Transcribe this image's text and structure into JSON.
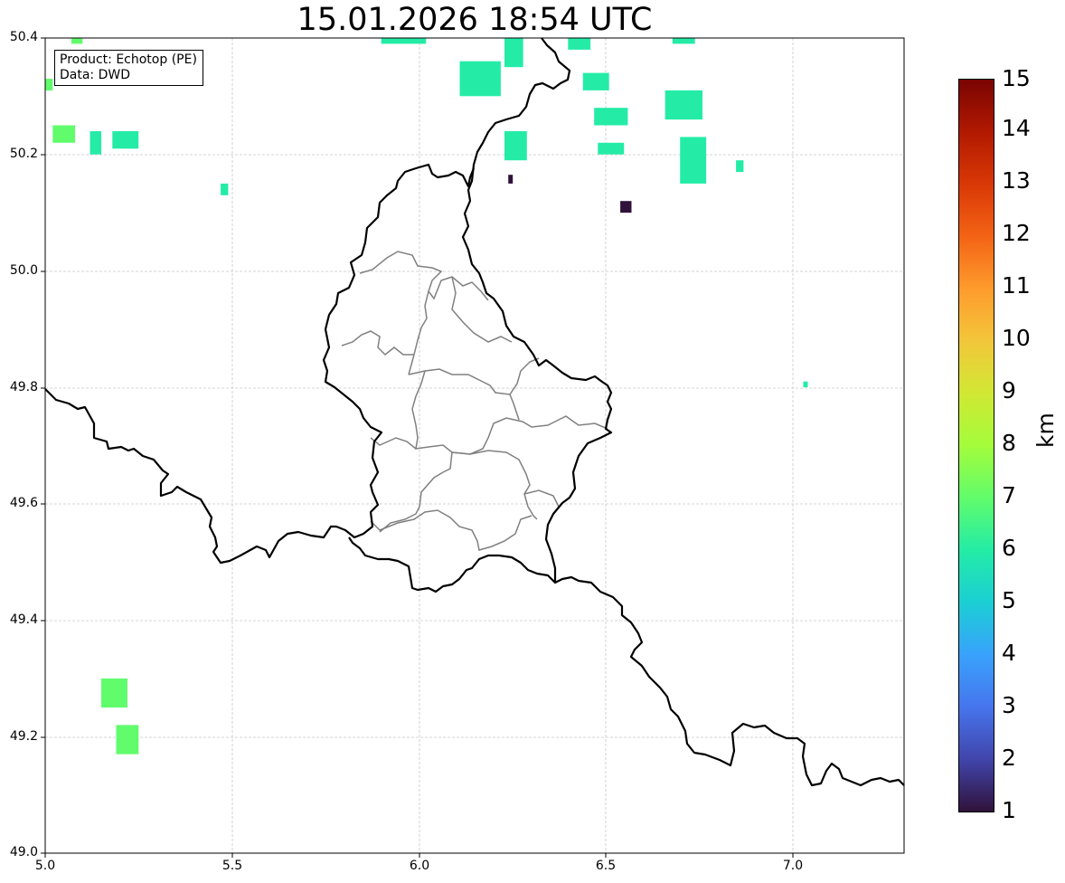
{
  "title": "15.01.2026 18:54 UTC",
  "info": {
    "product": "Product: Echotop (PE)",
    "data_source": "Data: DWD"
  },
  "axes": {
    "lon_range": [
      5.0,
      7.3
    ],
    "lat_range": [
      49.0,
      50.4
    ],
    "x_ticks": [
      "5.0",
      "5.5",
      "6.0",
      "6.5",
      "7.0"
    ],
    "y_ticks": [
      "49.0",
      "49.2",
      "49.4",
      "49.6",
      "49.8",
      "50.0",
      "50.2",
      "50.4"
    ],
    "grid": true
  },
  "colorbar": {
    "unit": "km",
    "range": [
      1,
      15
    ],
    "ticks": [
      "1",
      "2",
      "3",
      "4",
      "5",
      "6",
      "7",
      "8",
      "9",
      "10",
      "11",
      "12",
      "13",
      "14",
      "15"
    ],
    "colormap": [
      "#30123b",
      "#4145ab",
      "#4675ed",
      "#39a2fc",
      "#1bcfd4",
      "#24eca6",
      "#61fc6c",
      "#a4fc3b",
      "#d1e834",
      "#f3c63a",
      "#fe9b2d",
      "#f36315",
      "#d93806",
      "#b11901",
      "#7a0402"
    ]
  },
  "echo_cells": [
    {
      "lon_range": [
        5.0,
        5.02
      ],
      "lat_range": [
        50.31,
        50.33
      ],
      "height_km": 6.5
    },
    {
      "lon_range": [
        5.07,
        5.1
      ],
      "lat_range": [
        50.39,
        50.4
      ],
      "height_km": 6.5
    },
    {
      "lon_range": [
        5.02,
        5.08
      ],
      "lat_range": [
        50.22,
        50.25
      ],
      "height_km": 6.5
    },
    {
      "lon_range": [
        5.12,
        5.15
      ],
      "lat_range": [
        50.2,
        50.24
      ],
      "height_km": 6.3
    },
    {
      "lon_range": [
        5.18,
        5.25
      ],
      "lat_range": [
        50.21,
        50.24
      ],
      "height_km": 6.0
    },
    {
      "lon_range": [
        5.47,
        5.49
      ],
      "lat_range": [
        50.13,
        50.15
      ],
      "height_km": 6.0
    },
    {
      "lon_range": [
        5.15,
        5.22
      ],
      "lat_range": [
        49.25,
        49.3
      ],
      "height_km": 6.5
    },
    {
      "lon_range": [
        5.19,
        5.25
      ],
      "lat_range": [
        49.17,
        49.22
      ],
      "height_km": 6.5
    },
    {
      "lon_range": [
        5.9,
        6.02
      ],
      "lat_range": [
        50.39,
        50.4
      ],
      "height_km": 6.0
    },
    {
      "lon_range": [
        6.11,
        6.22
      ],
      "lat_range": [
        50.3,
        50.36
      ],
      "height_km": 5.8
    },
    {
      "lon_range": [
        6.23,
        6.28
      ],
      "lat_range": [
        50.35,
        50.4
      ],
      "height_km": 5.5
    },
    {
      "lon_range": [
        6.23,
        6.29
      ],
      "lat_range": [
        50.19,
        50.24
      ],
      "height_km": 6.0
    },
    {
      "lon_range": [
        6.4,
        6.46
      ],
      "lat_range": [
        50.38,
        50.4
      ],
      "height_km": 5.5
    },
    {
      "lon_range": [
        6.44,
        6.51
      ],
      "lat_range": [
        50.31,
        50.34
      ],
      "height_km": 5.5
    },
    {
      "lon_range": [
        6.47,
        6.56
      ],
      "lat_range": [
        50.25,
        50.28
      ],
      "height_km": 5.5
    },
    {
      "lon_range": [
        6.48,
        6.55
      ],
      "lat_range": [
        50.2,
        50.22
      ],
      "height_km": 6.0
    },
    {
      "lon_range": [
        6.66,
        6.76
      ],
      "lat_range": [
        50.26,
        50.31
      ],
      "height_km": 5.5
    },
    {
      "lon_range": [
        6.7,
        6.77
      ],
      "lat_range": [
        50.15,
        50.23
      ],
      "height_km": 6.0
    },
    {
      "lon_range": [
        6.68,
        6.74
      ],
      "lat_range": [
        50.39,
        50.4
      ],
      "height_km": 5.5
    },
    {
      "lon_range": [
        6.85,
        6.87
      ],
      "lat_range": [
        50.17,
        50.19
      ],
      "height_km": 6.0
    },
    {
      "lon_range": [
        7.03,
        7.04
      ],
      "lat_range": [
        49.8,
        49.81
      ],
      "height_km": 5.5
    },
    {
      "lon_range": [
        6.24,
        6.25
      ],
      "lat_range": [
        50.15,
        50.165
      ],
      "height_km": 1.0
    },
    {
      "lon_range": [
        6.54,
        6.57
      ],
      "lat_range": [
        50.1,
        50.12
      ],
      "height_km": 1.0
    }
  ]
}
